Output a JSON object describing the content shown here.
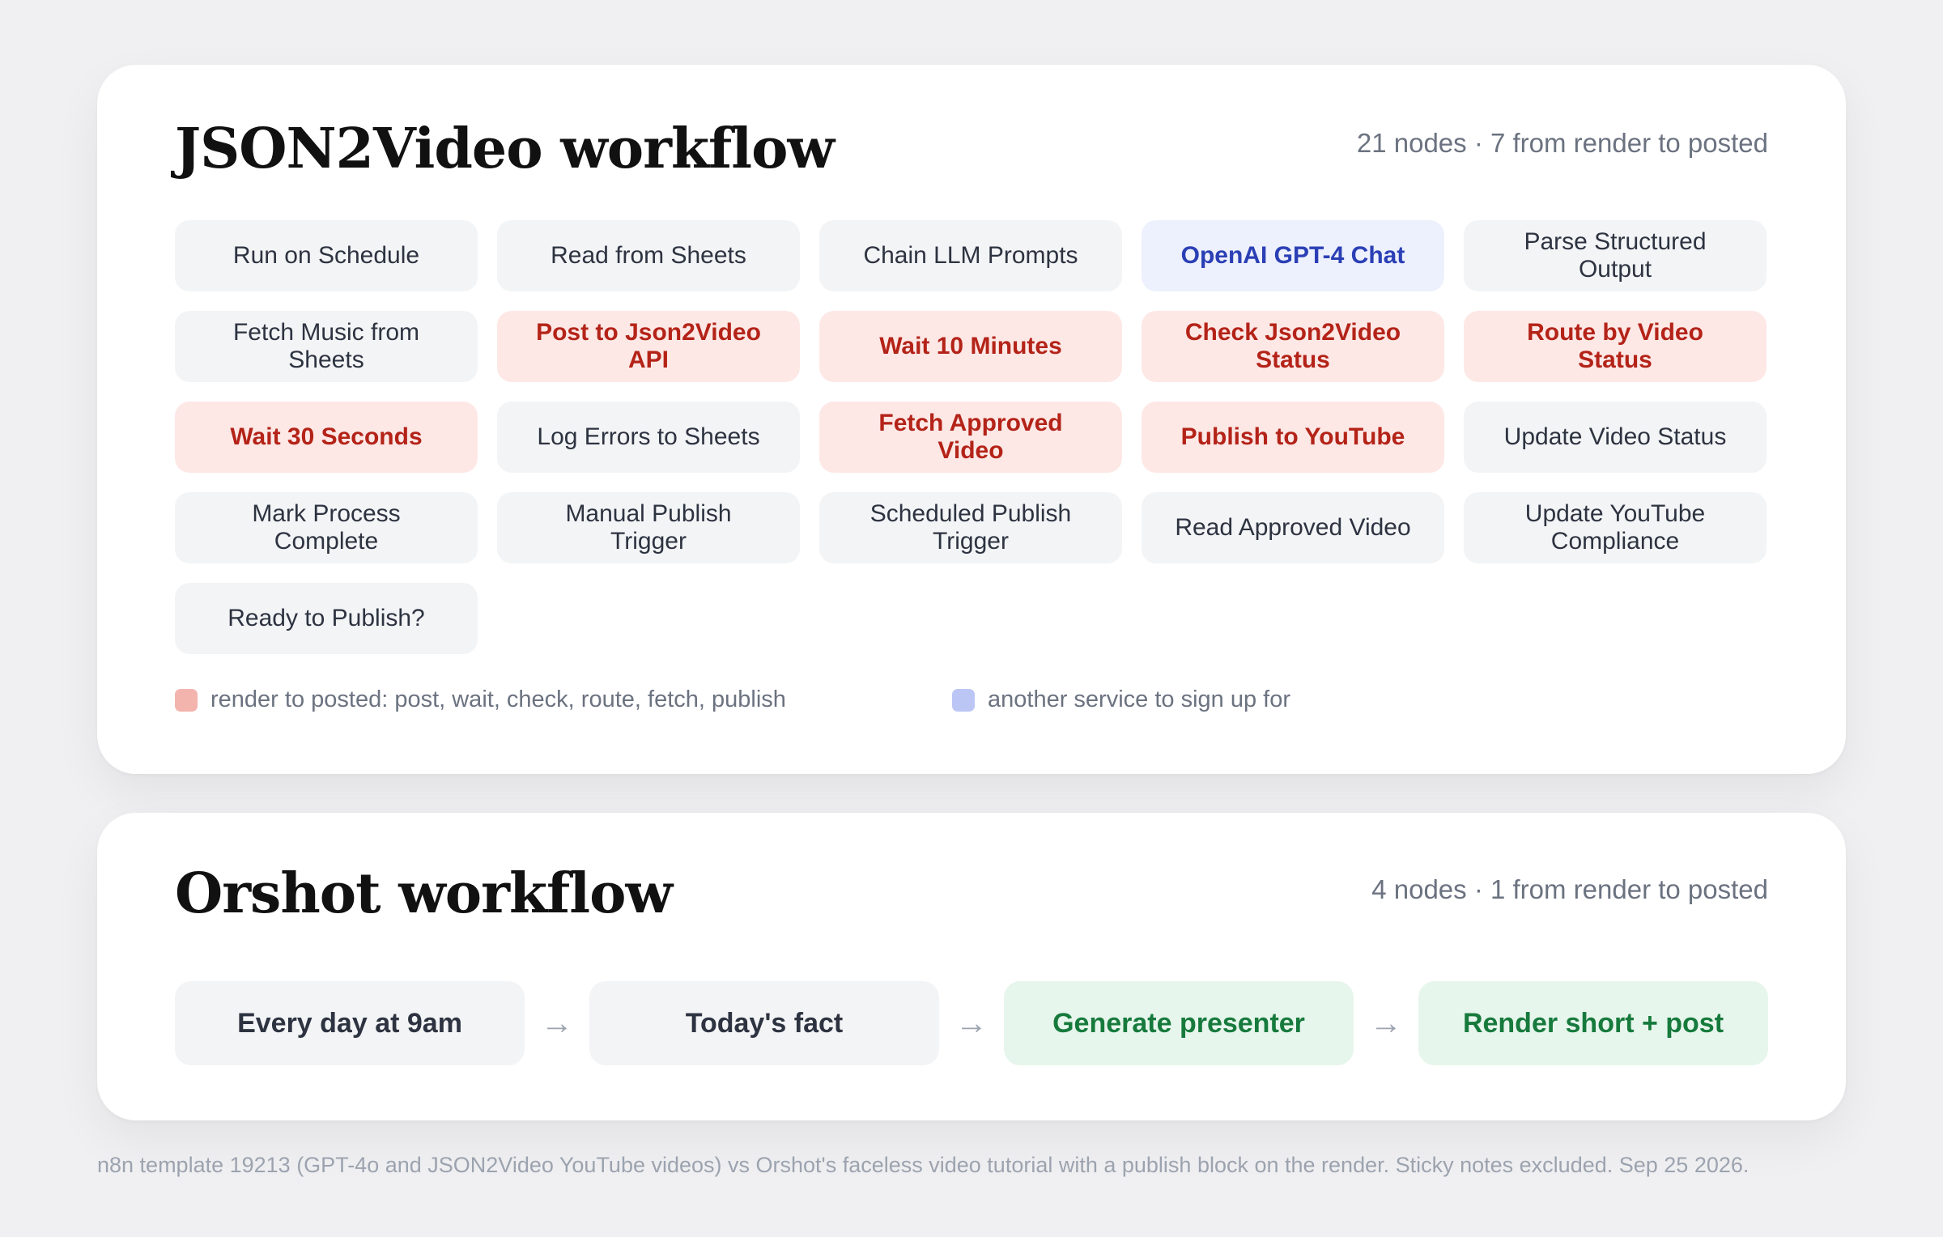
{
  "json2video": {
    "title": "JSON2Video workflow",
    "meta": "21 nodes · 7 from render to posted",
    "nodes": [
      {
        "label": "Run on Schedule",
        "kind": "plain"
      },
      {
        "label": "Read from Sheets",
        "kind": "plain"
      },
      {
        "label": "Chain LLM Prompts",
        "kind": "plain"
      },
      {
        "label": "OpenAI GPT-4 Chat",
        "kind": "service"
      },
      {
        "label": "Parse Structured Output",
        "kind": "plain"
      },
      {
        "label": "Fetch Music from Sheets",
        "kind": "plain"
      },
      {
        "label": "Post to Json2Video API",
        "kind": "render"
      },
      {
        "label": "Wait 10 Minutes",
        "kind": "render"
      },
      {
        "label": "Check Json2Video Status",
        "kind": "render"
      },
      {
        "label": "Route by Video Status",
        "kind": "render"
      },
      {
        "label": "Wait 30 Seconds",
        "kind": "render"
      },
      {
        "label": "Log Errors to Sheets",
        "kind": "plain"
      },
      {
        "label": "Fetch Approved Video",
        "kind": "render"
      },
      {
        "label": "Publish to YouTube",
        "kind": "render"
      },
      {
        "label": "Update Video Status",
        "kind": "plain"
      },
      {
        "label": "Mark Process Complete",
        "kind": "plain"
      },
      {
        "label": "Manual Publish Trigger",
        "kind": "plain"
      },
      {
        "label": "Scheduled Publish Trigger",
        "kind": "plain"
      },
      {
        "label": "Read Approved Video",
        "kind": "plain"
      },
      {
        "label": "Update YouTube Compliance",
        "kind": "plain"
      },
      {
        "label": "Ready to Publish?",
        "kind": "plain"
      }
    ],
    "legend": {
      "render_label": "render to posted: post, wait, check, route, fetch, publish",
      "service_label": "another service to sign up for"
    }
  },
  "orshot": {
    "title": "Orshot workflow",
    "meta": "4 nodes · 1 from render to posted",
    "steps": [
      {
        "label": "Every day at 9am",
        "kind": "plain"
      },
      {
        "label": "Today's fact",
        "kind": "plain"
      },
      {
        "label": "Generate presenter",
        "kind": "highlight"
      },
      {
        "label": "Render short + post",
        "kind": "highlight"
      }
    ],
    "arrow": "→"
  },
  "footnote": "n8n template 19213 (GPT-4o and JSON2Video YouTube videos) vs Orshot's faceless video tutorial with a publish block on the render. Sticky notes excluded. Sep 25 2026.",
  "colors": {
    "render": "#b42318",
    "service": "#2b3fb5",
    "highlight": "#177a3d"
  }
}
